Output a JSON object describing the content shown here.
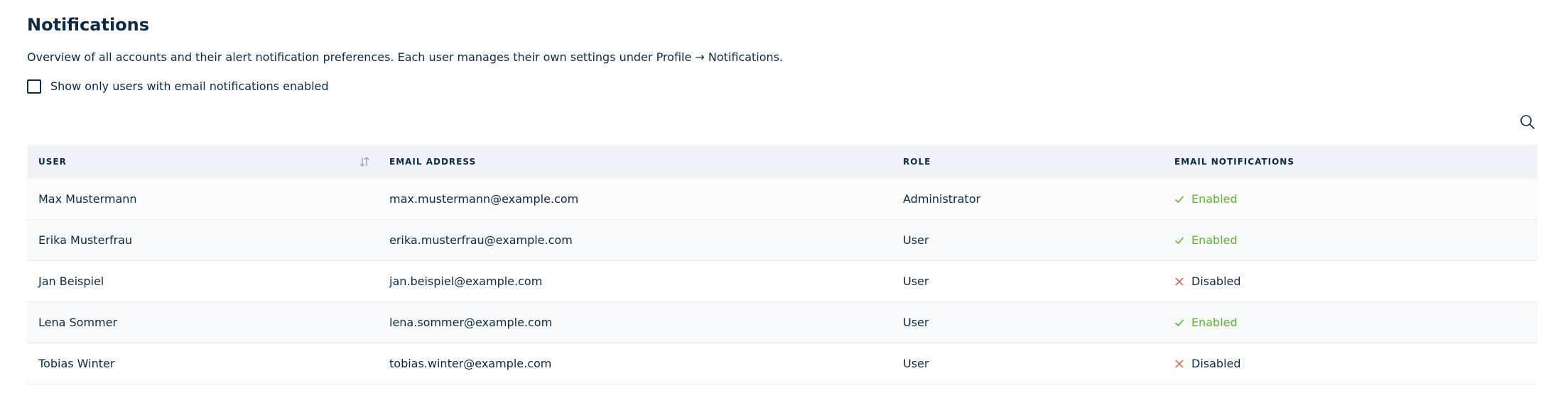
{
  "page": {
    "title": "Notifications",
    "description": "Overview of all accounts and their alert notification preferences. Each user manages their own settings under Profile → Notifications.",
    "filter_label": "Show only users with email notifications enabled",
    "filter_checked": false
  },
  "table": {
    "headers": {
      "user": "USER",
      "email": "EMAIL ADDRESS",
      "role": "ROLE",
      "notifications": "EMAIL NOTIFICATIONS"
    },
    "rows": [
      {
        "user": "Max Mustermann",
        "email": "max.mustermann@example.com",
        "role": "Administrator",
        "status": "Enabled",
        "status_icon": "check-icon"
      },
      {
        "user": "Erika Musterfrau",
        "email": "erika.musterfrau@example.com",
        "role": "User",
        "status": "Enabled",
        "status_icon": "check-icon"
      },
      {
        "user": "Jan Beispiel",
        "email": "jan.beispiel@example.com",
        "role": "User",
        "status": "Disabled",
        "status_icon": "cross-icon"
      },
      {
        "user": "Lena Sommer",
        "email": "lena.sommer@example.com",
        "role": "User",
        "status": "Enabled",
        "status_icon": "check-icon"
      },
      {
        "user": "Tobias Winter",
        "email": "tobias.winter@example.com",
        "role": "User",
        "status": "Disabled",
        "status_icon": "cross-icon"
      }
    ]
  },
  "colors": {
    "text": "#0c2a44",
    "enabled": "#5cb52f",
    "disabled_icon": "#e8604c",
    "header_bg": "#f0f4f9"
  },
  "icons": {
    "search": "search-icon",
    "sort": "sort-icon"
  }
}
